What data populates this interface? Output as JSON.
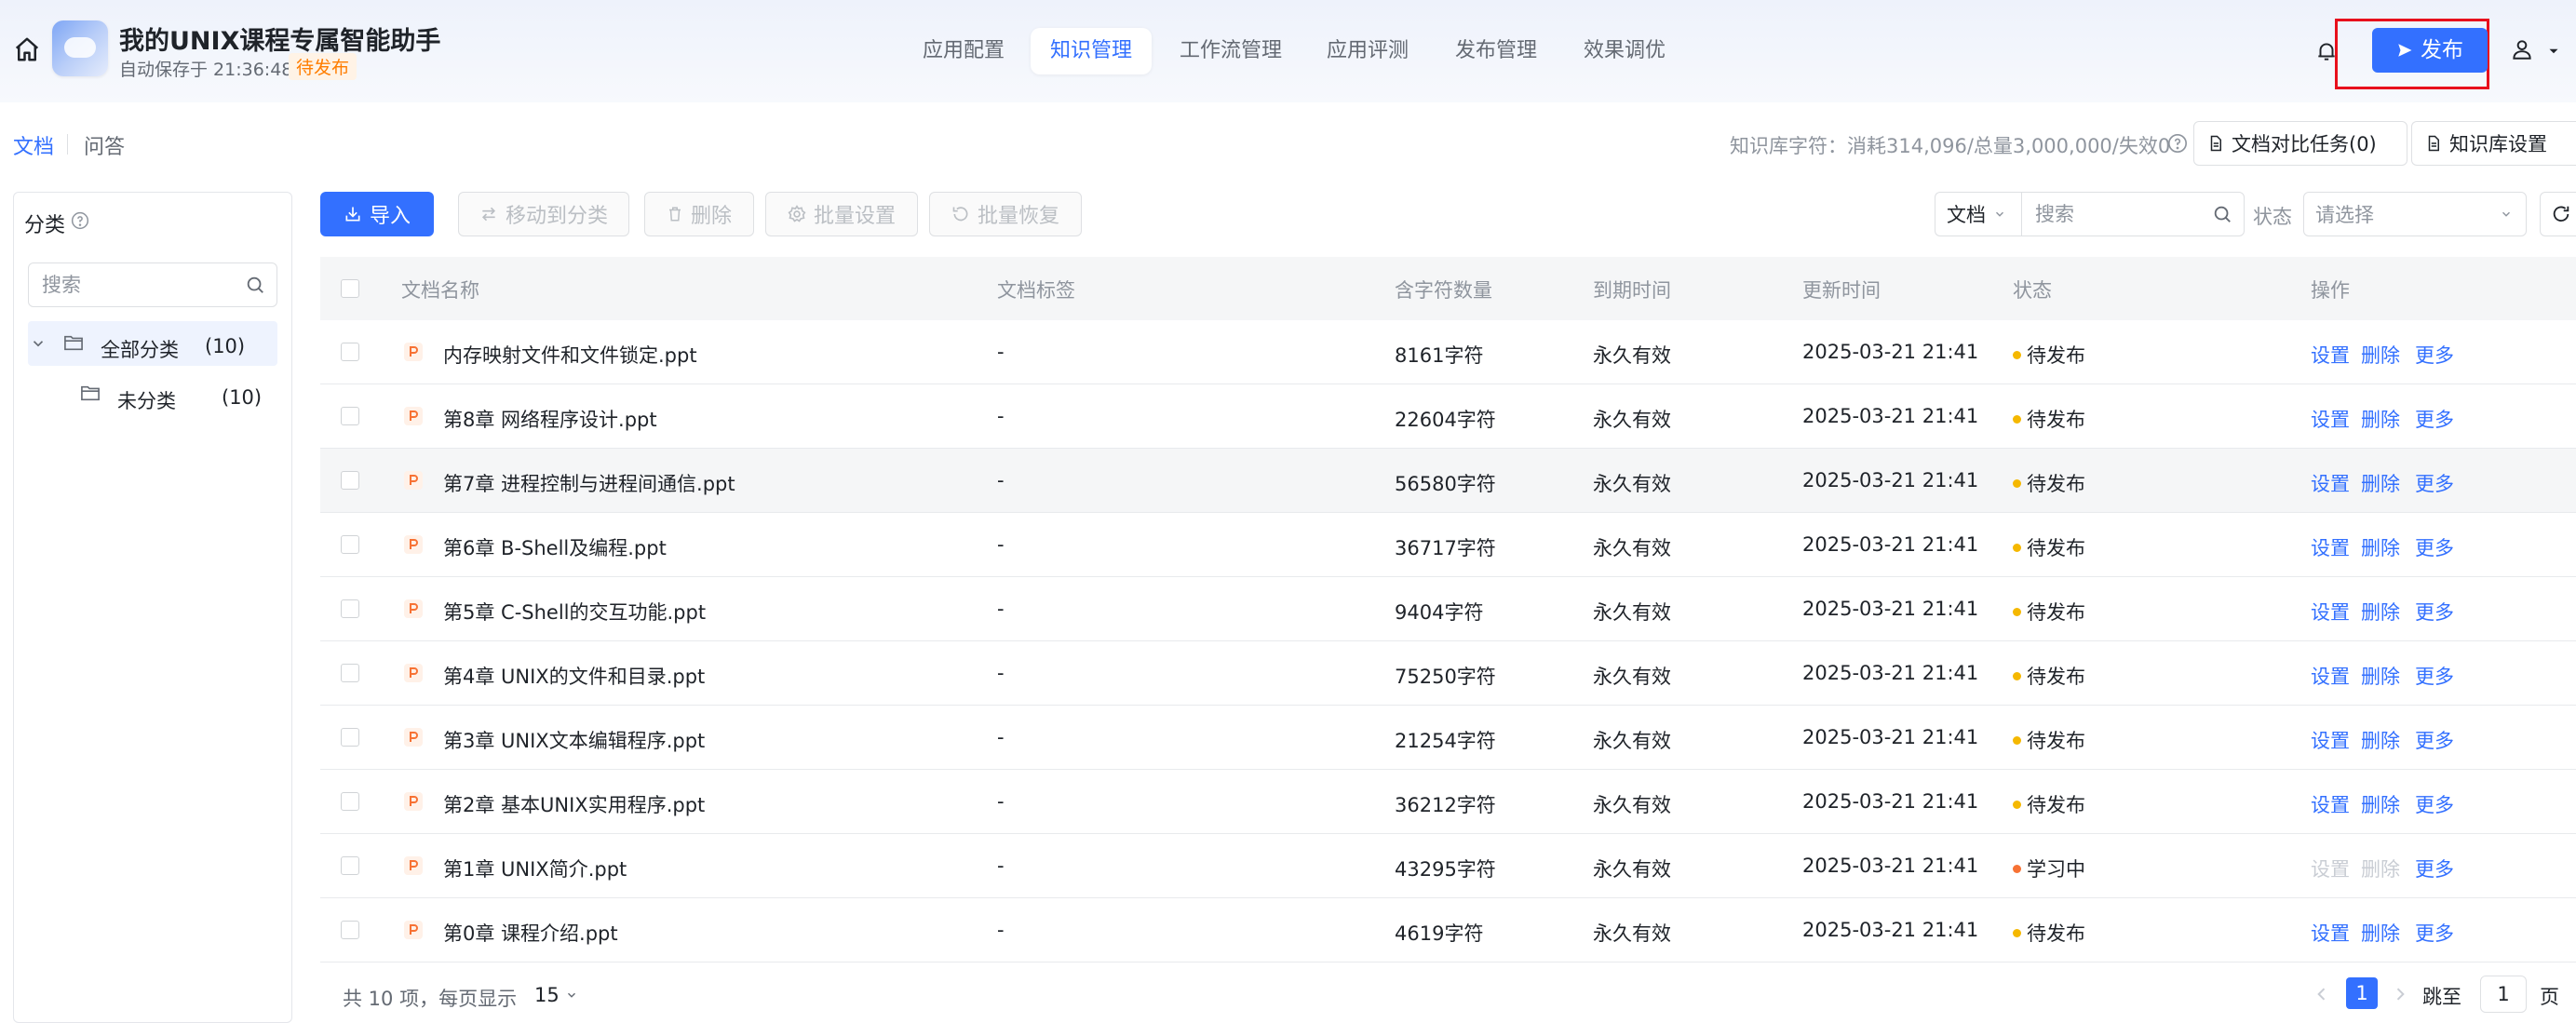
{
  "header": {
    "app_title": "我的UNIX课程专属智能助手",
    "autosave": "自动保存于 21:36:48",
    "status_tag": "待发布",
    "nav_tabs": [
      "应用配置",
      "知识管理",
      "工作流管理",
      "应用评测",
      "发布管理",
      "效果调优"
    ],
    "active_tab": "知识管理",
    "publish_label": "发布"
  },
  "subbar": {
    "tabs": [
      "文档",
      "问答"
    ],
    "active": "文档",
    "kb_usage": "知识库字符：消耗314,096/总量3,000,000/失效0",
    "compare_task_label": "文档对比任务(0)",
    "kb_settings_label": "知识库设置"
  },
  "sidebar": {
    "title": "分类",
    "search_placeholder": "搜索",
    "tree": [
      {
        "label": "全部分类",
        "count": "(10)",
        "selected": true
      },
      {
        "label": "未分类",
        "count": "(10)",
        "selected": false
      }
    ]
  },
  "toolbar": {
    "import_label": "导入",
    "move_label": "移动到分类",
    "delete_label": "删除",
    "batch_settings_label": "批量设置",
    "batch_restore_label": "批量恢复",
    "type_select_value": "文档",
    "search_placeholder": "搜索",
    "status_label": "状态",
    "status_placeholder": "请选择"
  },
  "table": {
    "headers": [
      "文档名称",
      "文档标签",
      "含字符数量",
      "到期时间",
      "更新时间",
      "状态",
      "操作"
    ],
    "rows": [
      {
        "name": "内存映射文件和文件锁定.ppt",
        "tag": "-",
        "chars": "8161字符",
        "expiry": "永久有效",
        "updated": "2025-03-21 21:41",
        "status": "待发布",
        "status_color": "#f5b800",
        "ops_disabled": false
      },
      {
        "name": "第8章 网络程序设计.ppt",
        "tag": "-",
        "chars": "22604字符",
        "expiry": "永久有效",
        "updated": "2025-03-21 21:41",
        "status": "待发布",
        "status_color": "#f5b800",
        "ops_disabled": false
      },
      {
        "name": "第7章 进程控制与进程间通信.ppt",
        "tag": "-",
        "chars": "56580字符",
        "expiry": "永久有效",
        "updated": "2025-03-21 21:41",
        "status": "待发布",
        "status_color": "#f5b800",
        "ops_disabled": false
      },
      {
        "name": "第6章 B-Shell及编程.ppt",
        "tag": "-",
        "chars": "36717字符",
        "expiry": "永久有效",
        "updated": "2025-03-21 21:41",
        "status": "待发布",
        "status_color": "#f5b800",
        "ops_disabled": false
      },
      {
        "name": "第5章 C-Shell的交互功能.ppt",
        "tag": "-",
        "chars": "9404字符",
        "expiry": "永久有效",
        "updated": "2025-03-21 21:41",
        "status": "待发布",
        "status_color": "#f5b800",
        "ops_disabled": false
      },
      {
        "name": "第4章 UNIX的文件和目录.ppt",
        "tag": "-",
        "chars": "75250字符",
        "expiry": "永久有效",
        "updated": "2025-03-21 21:41",
        "status": "待发布",
        "status_color": "#f5b800",
        "ops_disabled": false
      },
      {
        "name": "第3章 UNIX文本编辑程序.ppt",
        "tag": "-",
        "chars": "21254字符",
        "expiry": "永久有效",
        "updated": "2025-03-21 21:41",
        "status": "待发布",
        "status_color": "#f5b800",
        "ops_disabled": false
      },
      {
        "name": "第2章 基本UNIX实用程序.ppt",
        "tag": "-",
        "chars": "36212字符",
        "expiry": "永久有效",
        "updated": "2025-03-21 21:41",
        "status": "待发布",
        "status_color": "#f5b800",
        "ops_disabled": false
      },
      {
        "name": "第1章 UNIX简介.ppt",
        "tag": "-",
        "chars": "43295字符",
        "expiry": "永久有效",
        "updated": "2025-03-21 21:41",
        "status": "学习中",
        "status_color": "#f77234",
        "ops_disabled": true
      },
      {
        "name": "第0章 课程介绍.ppt",
        "tag": "-",
        "chars": "4619字符",
        "expiry": "永久有效",
        "updated": "2025-03-21 21:41",
        "status": "待发布",
        "status_color": "#f5b800",
        "ops_disabled": false
      }
    ],
    "ops": {
      "settings": "设置",
      "delete": "删除",
      "more": "更多"
    }
  },
  "footer": {
    "total_text": "共 10 项，每页显示",
    "page_size": "15",
    "current_page": "1",
    "jump_label": "跳至",
    "jump_value": "1",
    "page_unit": "页"
  },
  "colors": {
    "accent": "#3370ff",
    "pending": "#f5b800",
    "learning": "#f77234",
    "highlight": "#e8101c"
  },
  "icons": [
    "home-icon",
    "bell-icon",
    "user-icon",
    "help-icon",
    "search-icon",
    "folder-icon",
    "ppt-file-icon",
    "refresh-icon",
    "send-icon",
    "import-icon",
    "move-icon",
    "trash-icon",
    "settings-icon",
    "restore-icon",
    "document-icon"
  ]
}
